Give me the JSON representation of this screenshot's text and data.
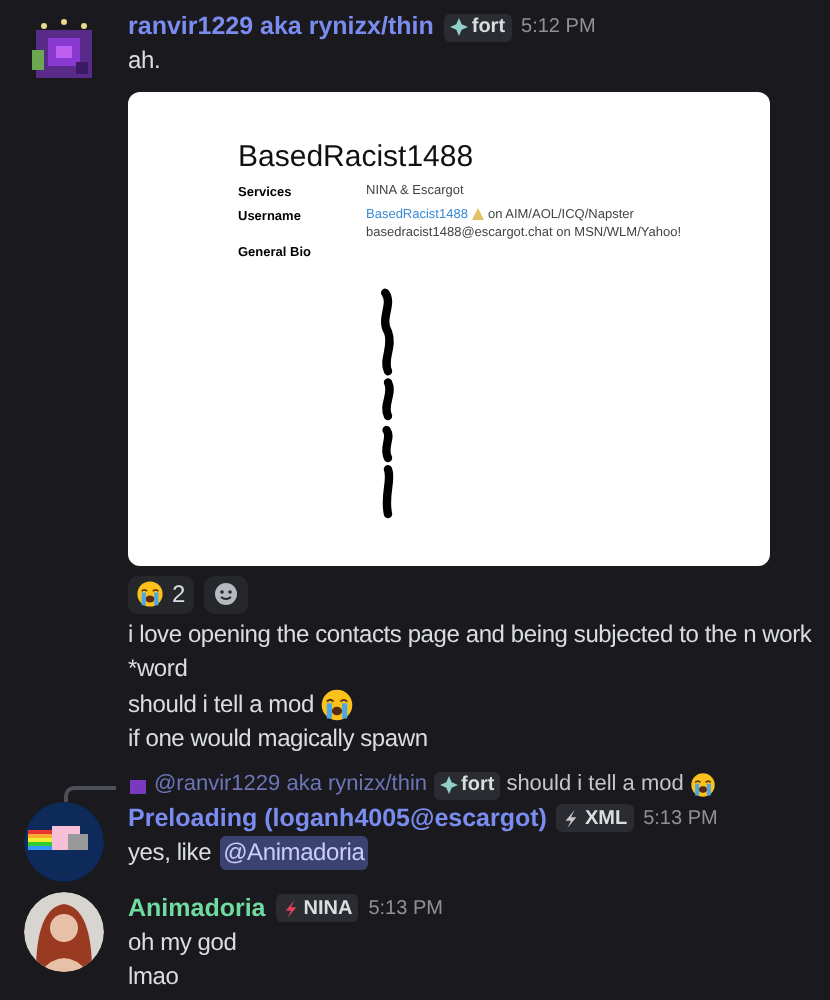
{
  "messages": [
    {
      "author": "ranvir1229 aka rynizx/thin",
      "color": "#7b8cf0",
      "tag": {
        "label": "fort"
      },
      "time": "5:12 PM",
      "lines": [
        {
          "text": "ah.",
          "crying_emoji": false
        }
      ],
      "attachment": {
        "title": "BasedRacist1488",
        "fields": [
          {
            "label": "Services",
            "values": [
              {
                "text": "NINA & Escargot"
              }
            ]
          },
          {
            "label": "Username",
            "values": [
              {
                "link": "BasedRacist1488",
                "text": "on AIM/AOL/ICQ/Napster"
              },
              {
                "text": "basedracist1488@escargot.chat on MSN/WLM/Yahoo!"
              }
            ]
          },
          {
            "label": "General Bio"
          }
        ]
      },
      "reactions": [
        {
          "kind": "emoji",
          "count": "2",
          "selected": false
        },
        {
          "kind": "add"
        }
      ],
      "more_lines": [
        {
          "text": "i love opening the contacts page and being subjected to the n work",
          "crying_emoji": false
        },
        {
          "text": "*word",
          "crying_emoji": false
        },
        {
          "text": "should i tell a mod",
          "crying_emoji": true
        },
        {
          "text": "if one would magically spawn",
          "crying_emoji": false
        }
      ]
    },
    {
      "reply": {
        "author": "@ranvir1229 aka rynizx/thin",
        "tag": {
          "label": "fort"
        },
        "text": "should i tell a mod",
        "crying_emoji": true
      },
      "author": "Preloading (loganh4005@escargot)",
      "color": "#7b8cf0",
      "tag": {
        "label": "XML"
      },
      "time": "5:13 PM",
      "lines": [
        {
          "text": "yes, like",
          "mention": "@Animadoria",
          "crying_emoji": false
        }
      ]
    },
    {
      "author": "Animadoria",
      "color": "#6fdba0",
      "tag": {
        "label": "NINA"
      },
      "time": "5:13 PM",
      "lines": [
        {
          "text": "oh my god",
          "crying_emoji": false
        },
        {
          "text": "lmao",
          "crying_emoji": false
        }
      ]
    }
  ]
}
